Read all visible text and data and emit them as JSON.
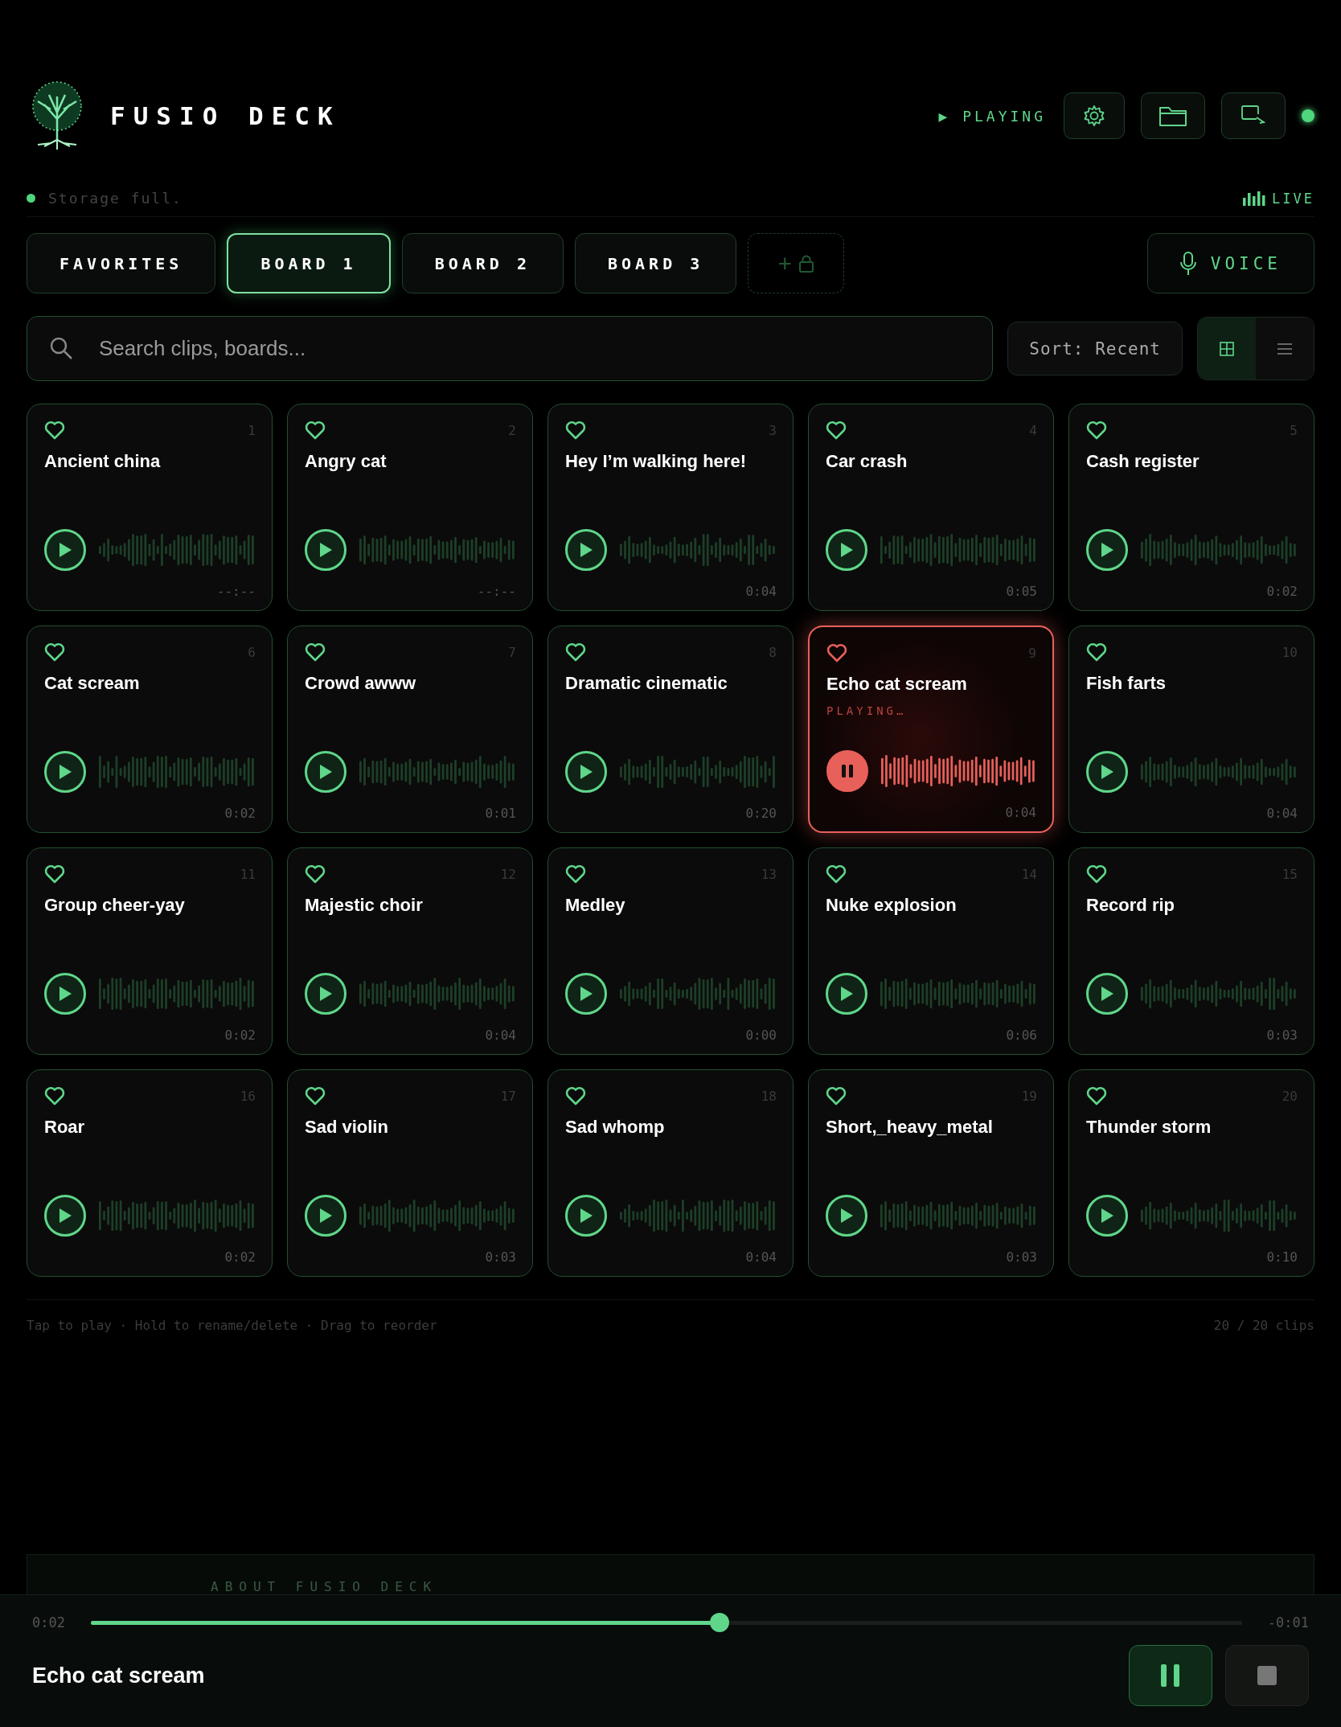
{
  "header": {
    "title": "FUSIO DECK",
    "now_status": "▶ PLAYING"
  },
  "status": {
    "message": "Storage full.",
    "live": "LIVE"
  },
  "tabs": [
    {
      "label": "FAVORITES",
      "selected": false
    },
    {
      "label": "BOARD 1",
      "selected": true
    },
    {
      "label": "BOARD 2",
      "selected": false
    },
    {
      "label": "BOARD 3",
      "selected": false
    }
  ],
  "add_board": "+",
  "voice_button": "VOICE",
  "search": {
    "placeholder": "Search clips, boards..."
  },
  "sort": "Sort: Recent",
  "view_toggle": [
    {
      "kind": "grid",
      "selected": true
    },
    {
      "kind": "list",
      "selected": false
    }
  ],
  "clips": [
    {
      "title": "Ancient china",
      "number": "1",
      "duration": "--:--",
      "playing": false
    },
    {
      "title": "Angry cat",
      "number": "2",
      "duration": "--:--",
      "playing": false
    },
    {
      "title": "Hey I’m walking here!",
      "number": "3",
      "duration": "0:04",
      "playing": false
    },
    {
      "title": "Car crash",
      "number": "4",
      "duration": "0:05",
      "playing": false
    },
    {
      "title": "Cash register",
      "number": "5",
      "duration": "0:02",
      "playing": false
    },
    {
      "title": "Cat scream",
      "number": "6",
      "duration": "0:02",
      "playing": false
    },
    {
      "title": "Crowd awww",
      "number": "7",
      "duration": "0:01",
      "playing": false
    },
    {
      "title": "Dramatic cinematic",
      "number": "8",
      "duration": "0:20",
      "playing": false
    },
    {
      "title": "Echo cat scream",
      "number": "9",
      "duration": "0:04",
      "playing": true,
      "status": "PLAYING…"
    },
    {
      "title": "Fish farts",
      "number": "10",
      "duration": "0:04",
      "playing": false
    },
    {
      "title": "Group cheer-yay",
      "number": "11",
      "duration": "0:02",
      "playing": false
    },
    {
      "title": "Majestic choir",
      "number": "12",
      "duration": "0:04",
      "playing": false
    },
    {
      "title": "Medley",
      "number": "13",
      "duration": "0:00",
      "playing": false
    },
    {
      "title": "Nuke explosion",
      "number": "14",
      "duration": "0:06",
      "playing": false
    },
    {
      "title": "Record rip",
      "number": "15",
      "duration": "0:03",
      "playing": false
    },
    {
      "title": "Roar",
      "number": "16",
      "duration": "0:02",
      "playing": false
    },
    {
      "title": "Sad violin",
      "number": "17",
      "duration": "0:03",
      "playing": false
    },
    {
      "title": "Sad whomp",
      "number": "18",
      "duration": "0:04",
      "playing": false
    },
    {
      "title": "Short,_heavy_metal",
      "number": "19",
      "duration": "0:03",
      "playing": false
    },
    {
      "title": "Thunder storm",
      "number": "20",
      "duration": "0:10",
      "playing": false
    }
  ],
  "footer": {
    "hint": "Tap to play · Hold to rename/delete · Drag to reorder",
    "count": "20 / 20 clips"
  },
  "about": {
    "title": "ABOUT FUSIO DECK"
  },
  "player": {
    "elapsed": "0:02",
    "remaining": "-0:01",
    "level": 0.546,
    "title": "Echo cat scream"
  }
}
